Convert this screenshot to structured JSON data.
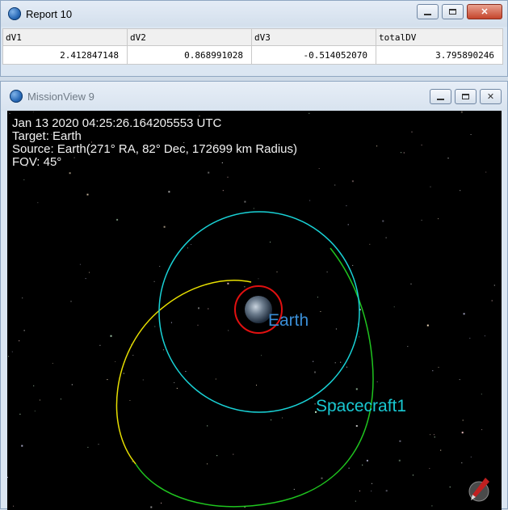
{
  "report_window": {
    "title": "Report 10",
    "columns": [
      "dV1",
      "dV2",
      "dV3",
      "totalDV"
    ],
    "rows": [
      [
        "2.412847148",
        "0.868991028",
        "-0.514052070",
        "3.795890246"
      ]
    ]
  },
  "mission_view": {
    "title": "MissionView 9",
    "overlay": {
      "epoch": "Jan 13 2020 04:25:26.164205553 UTC",
      "target": "Target: Earth",
      "source": "Source: Earth(271° RA, 82° Dec, 172699 km Radius)",
      "fov": "FOV: 45°"
    },
    "bodies": {
      "earth_label": "Earth",
      "spacecraft_label": "Spacecraft1"
    },
    "colors": {
      "background": "#000000",
      "earth_label": "#3a8ed6",
      "spacecraft_label": "#19c8d2",
      "cyan_orbit": "#19d2d6",
      "green_orbit": "#1fc41f",
      "yellow_orbit": "#e8e000",
      "red_orbit": "#e01010"
    },
    "icons": [
      "app-globe-icon",
      "minimize-icon",
      "maximize-icon",
      "close-icon",
      "compass-icon"
    ]
  }
}
